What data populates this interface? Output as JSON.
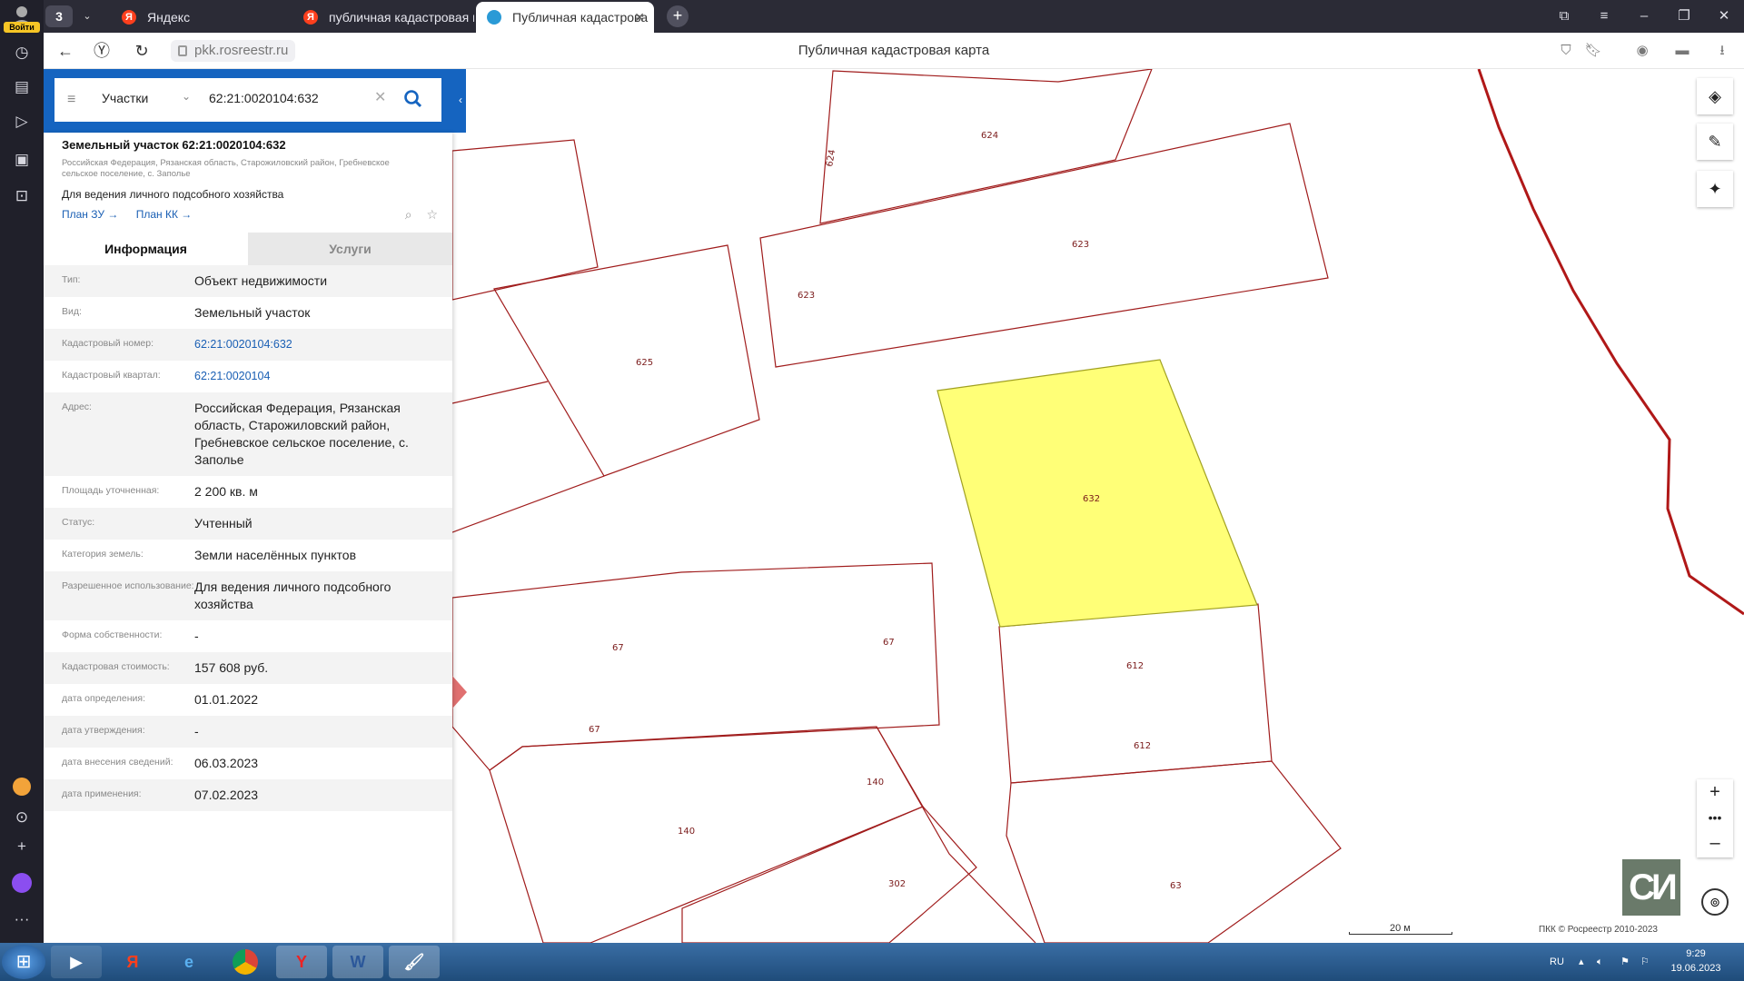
{
  "browser": {
    "login_label": "Войти",
    "tab_count": "3",
    "tabs": [
      {
        "label": "Яндекс"
      },
      {
        "label": "публичная кадастровая к"
      },
      {
        "label": "Публичная кадастрова"
      }
    ],
    "url": "pkk.rosreestr.ru",
    "page_title": "Публичная кадастровая карта"
  },
  "search": {
    "type": "Участки",
    "query": "62:21:0020104:632"
  },
  "object": {
    "title": "Земельный участок 62:21:0020104:632",
    "address": "Российская Федерация, Рязанская область, Старожиловский район, Гребневское сельское поселение, с. Заполье",
    "use": "Для ведения личного подсобного хозяйства",
    "link_plan_zu": "План ЗУ →",
    "link_plan_kk": "План КК →"
  },
  "tabs": {
    "info": "Информация",
    "services": "Услуги"
  },
  "rows": [
    {
      "k": "Тип:",
      "v": "Объект недвижимости"
    },
    {
      "k": "Вид:",
      "v": "Земельный участок"
    },
    {
      "k": "Кадастровый номер:",
      "v": "62:21:0020104:632"
    },
    {
      "k": "Кадастровый квартал:",
      "v": "62:21:0020104"
    },
    {
      "k": "Адрес:",
      "v": "Российская Федерация, Рязанская область, Старожиловский район, Гребневское сельское поселение, с. Заполье"
    },
    {
      "k": "Площадь уточненная:",
      "v": "2 200 кв. м"
    },
    {
      "k": "Статус:",
      "v": "Учтенный"
    },
    {
      "k": "Категория земель:",
      "v": "Земли населённых пунктов"
    },
    {
      "k": "Разрешенное использование:",
      "v": "Для ведения личного подсобного хозяйства"
    },
    {
      "k": "Форма собственности:",
      "v": "-"
    },
    {
      "k": "Кадастровая стоимость:",
      "v": "157 608 руб."
    },
    {
      "k": "дата определения:",
      "v": "01.01.2022"
    },
    {
      "k": "дата утверждения:",
      "v": "-"
    },
    {
      "k": "дата внесения сведений:",
      "v": "06.03.2023"
    },
    {
      "k": "дата применения:",
      "v": "07.02.2023"
    }
  ],
  "map": {
    "parcel_labels": [
      "624",
      "624",
      "623",
      "623",
      "625",
      "632",
      "67",
      "67",
      "67",
      "612",
      "612",
      "140",
      "140",
      "302",
      "63"
    ],
    "scale": "20 м",
    "copyright": "ПКК © Росреестр 2010-2023",
    "highlight_color": "#ffff77",
    "boundary_color": "#a01c1c"
  },
  "taskbar": {
    "lang": "RU",
    "time": "9:29",
    "date": "19.06.2023"
  }
}
